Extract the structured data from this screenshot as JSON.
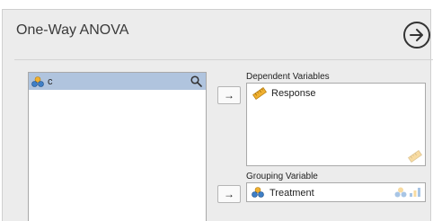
{
  "analysis": {
    "title": "One-Way ANOVA"
  },
  "source": {
    "items": [
      {
        "label": "c",
        "icon": "nominal-variable-icon"
      }
    ]
  },
  "dependent": {
    "label": "Dependent Variables",
    "items": [
      {
        "label": "Response",
        "icon": "scale-variable-icon"
      }
    ],
    "allowed_icon": "scale-variable-icon"
  },
  "grouping": {
    "label": "Grouping Variable",
    "items": [
      {
        "label": "Treatment",
        "icon": "nominal-text-variable-icon"
      }
    ],
    "allowed_icons": [
      "nominal-variable-icon",
      "ordinal-variable-icon"
    ]
  },
  "colors": {
    "selected_row": "#b0c4de",
    "scale_icon": "#f0b030",
    "nominal_icon": "#3f7fc6"
  },
  "move_arrow": "→"
}
